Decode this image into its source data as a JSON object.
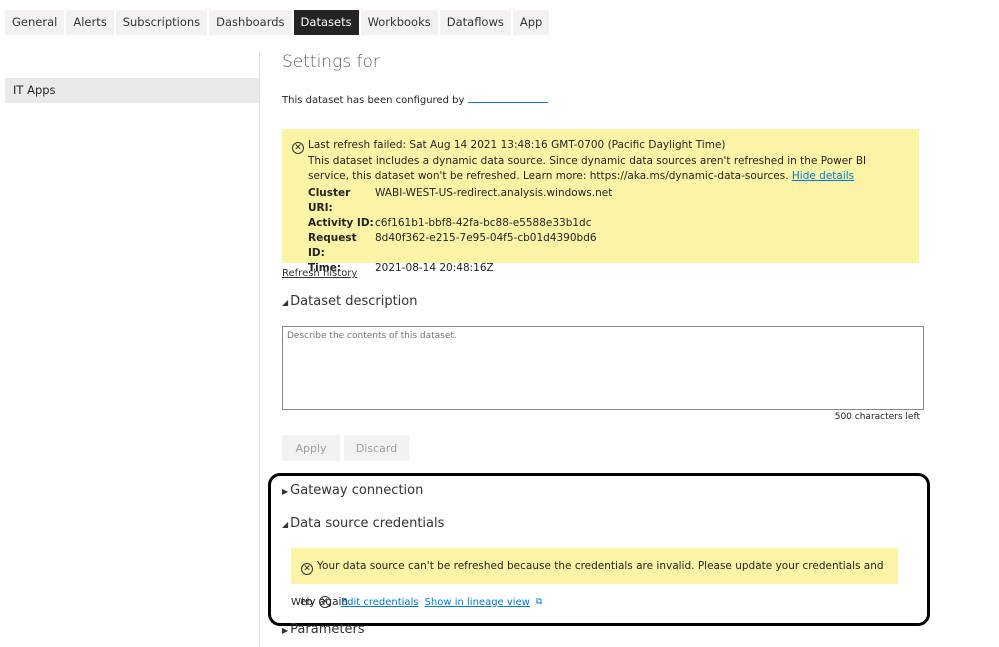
{
  "tabs": [
    "General",
    "Alerts",
    "Subscriptions",
    "Dashboards",
    "Datasets",
    "Workbooks",
    "Dataflows",
    "App"
  ],
  "active_tab": "Datasets",
  "sidebar": {
    "items": [
      {
        "label": "IT Apps"
      }
    ]
  },
  "main": {
    "title": "Settings for",
    "configured_by": "This dataset has been configured by",
    "refresh_banner": {
      "headline": "Last refresh failed: Sat Aug 14 2021 13:48:16 GMT-0700 (Pacific Daylight Time)",
      "message": "This dataset includes a dynamic data source. Since dynamic data sources aren't refreshed in the Power BI service, this dataset won't be refreshed. Learn more: https://aka.ms/dynamic-data-sources.",
      "hide_details": "Hide details",
      "details": [
        {
          "key": "Cluster URI:",
          "value": "WABI-WEST-US-redirect.analysis.windows.net"
        },
        {
          "key": "Activity ID:",
          "value": "c6f161b1-bbf8-42fa-bc88-e5588e33b1dc"
        },
        {
          "key": "Request ID:",
          "value": "8d40f362-e215-7e95-04f5-cb01d4390bd6"
        },
        {
          "key": "Time:",
          "value": "2021-08-14 20:48:16Z"
        }
      ]
    },
    "refresh_history": "Refresh history",
    "description": {
      "title": "Dataset description",
      "placeholder": "Describe the contents of this dataset.",
      "chars_left": "500 characters left",
      "apply": "Apply",
      "discard": "Discard"
    },
    "gateway": "Gateway connection",
    "credentials": {
      "title": "Data source credentials",
      "error": "Your data source can't be refreshed because the credentials are invalid. Please update your credentials and try again.",
      "source": "Web",
      "edit": "Edit credentials",
      "lineage": "Show in lineage view"
    },
    "parameters": "Parameters"
  },
  "colors": {
    "banner": "#fbf4a6",
    "link": "#0078d4",
    "active_tab": "#252423"
  }
}
